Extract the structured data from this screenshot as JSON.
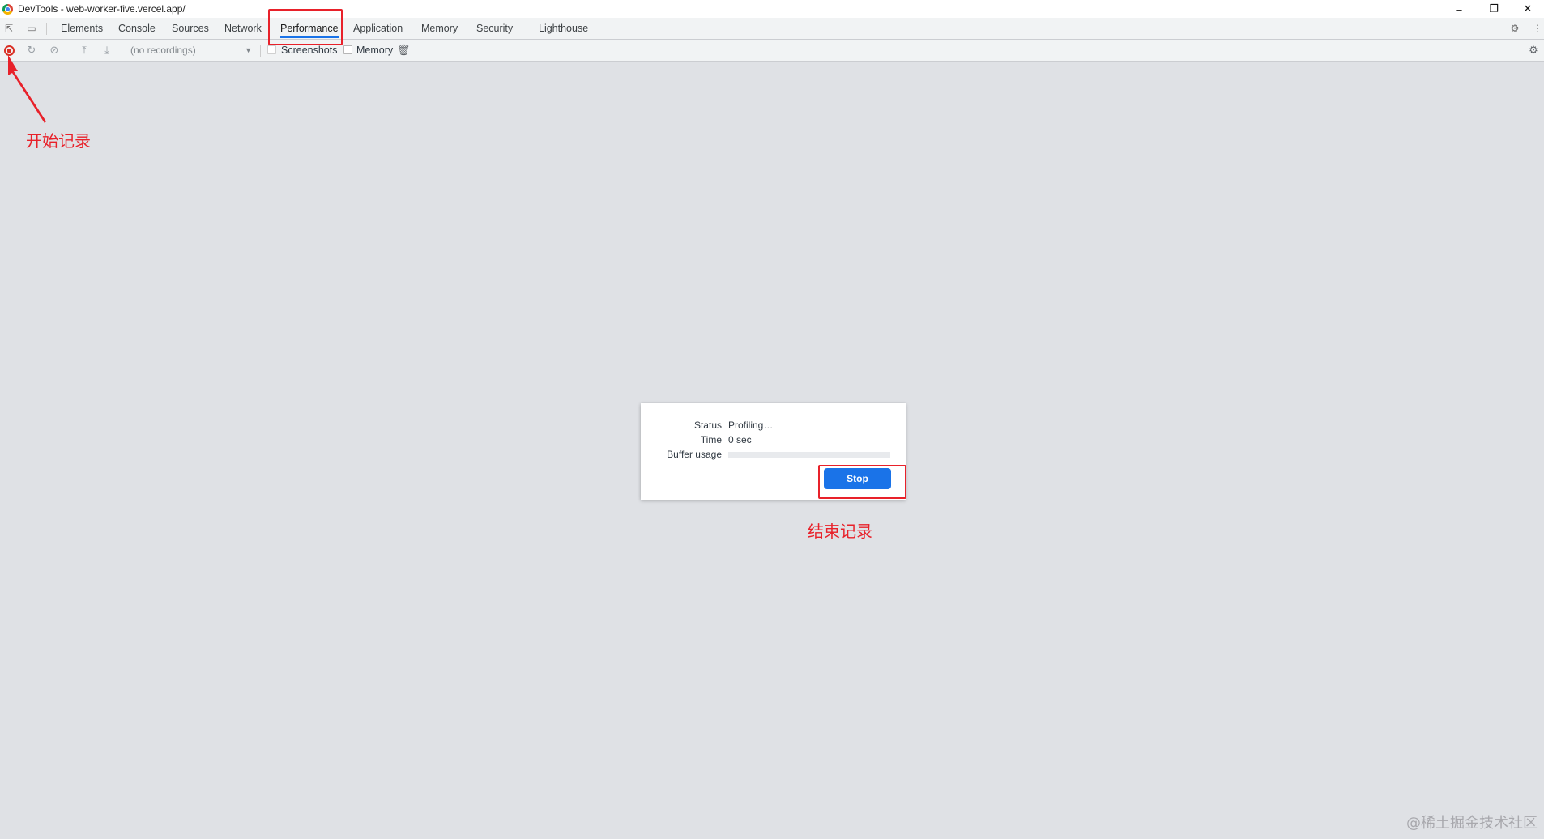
{
  "window": {
    "title": "DevTools - web-worker-five.vercel.app/",
    "minimize_icon": "minimize-icon",
    "restore_icon": "restore-icon",
    "close_icon": "close-icon"
  },
  "tabs": [
    {
      "label": "Elements"
    },
    {
      "label": "Console"
    },
    {
      "label": "Sources"
    },
    {
      "label": "Network"
    },
    {
      "label": "Performance",
      "active": true
    },
    {
      "label": "Application"
    },
    {
      "label": "Memory"
    },
    {
      "label": "Security"
    },
    {
      "label": "Lighthouse"
    }
  ],
  "toolbar": {
    "recordings_placeholder": "(no recordings)",
    "screenshots_label": "Screenshots",
    "memory_label": "Memory"
  },
  "dialog": {
    "status_label": "Status",
    "status_value": "Profiling…",
    "time_label": "Time",
    "time_value": "0 sec",
    "buffer_label": "Buffer usage",
    "buffer_usage_fraction": 0,
    "stop_label": "Stop"
  },
  "annotations": {
    "start_recording": "开始记录",
    "stop_recording": "结束记录",
    "color": "#e8212a"
  },
  "watermark": "@稀土掘金技术社区",
  "colors": {
    "accent": "#1a73e8",
    "record": "#d93025",
    "background": "#dfe1e5"
  }
}
